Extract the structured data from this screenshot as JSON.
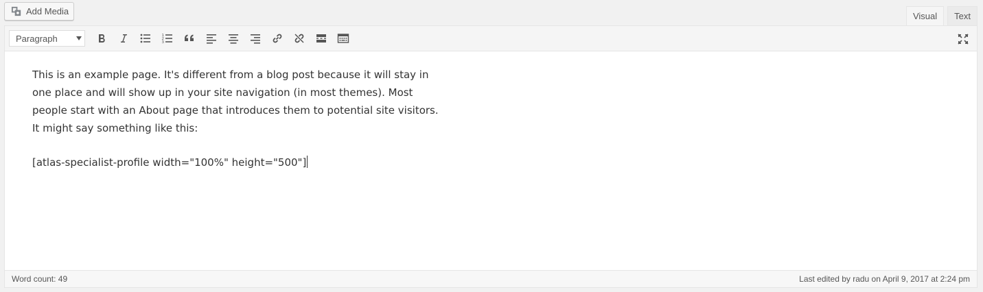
{
  "add_media": {
    "label": "Add Media",
    "icon": "media-icon"
  },
  "tabs": [
    {
      "label": "Visual",
      "active": true
    },
    {
      "label": "Text",
      "active": false
    }
  ],
  "toolbar": {
    "format_value": "Paragraph",
    "buttons": [
      "bold-icon",
      "italic-icon",
      "bullet-list-icon",
      "numbered-list-icon",
      "blockquote-icon",
      "align-left-icon",
      "align-center-icon",
      "align-right-icon",
      "link-icon",
      "unlink-icon",
      "read-more-icon",
      "toolbar-toggle-icon"
    ],
    "fullscreen_icon": "fullscreen-icon"
  },
  "content": {
    "paragraph_lines": [
      "This is an example page. It's different from a blog post because it will stay in",
      "one place and will show up in your site navigation (in most themes). Most",
      "people start with an About page that introduces them to potential site visitors.",
      "It might say something like this:"
    ],
    "shortcode": "[atlas-specialist-profile width=\"100%\" height=\"500\"]"
  },
  "status": {
    "word_count": "Word count: 49",
    "last_edited": "Last edited by radu on April 9, 2017 at 2:24 pm"
  }
}
